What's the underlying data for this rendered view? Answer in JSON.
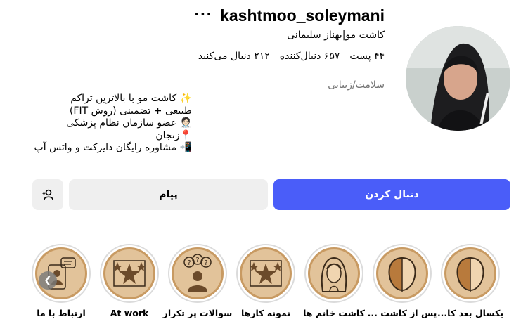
{
  "profile": {
    "username": "kashtmoo_soleymani",
    "more_glyph": "···",
    "full_name": "کاشت مو|بهناز سلیمانی",
    "stats": {
      "posts": "۴۴ پست",
      "followers": "۶۵۷ دنبال‌کننده",
      "following": "۲۱۲ دنبال می‌کنید"
    },
    "category": "سلامت/زیبایی",
    "bio": [
      "✨ کاشت مو با بالاترین تراکم",
      "طبیعی + تضمینی (روش FIT)",
      "🧑🏻‍⚕️ عضو سازمان نظام پزشکی",
      "📍زنجان",
      "📲 مشاوره رایگان دایرکت و واتس آپ"
    ]
  },
  "actions": {
    "follow_label": "دنبال کردن",
    "message_label": "پیام"
  },
  "highlights": [
    {
      "label": "یکسال بعد کا...",
      "icon": "hair-transplant-face-icon"
    },
    {
      "label": "پس از کاشت ...",
      "icon": "hair-transplant-face-icon"
    },
    {
      "label": "کاشت خانم ها",
      "icon": "woman-icon"
    },
    {
      "label": "نمونه کارها",
      "icon": "star-icon"
    },
    {
      "label": "سوالات پر تکرار",
      "icon": "faq-person-icon"
    },
    {
      "label": "At work",
      "icon": "star-icon"
    },
    {
      "label": "ارتباط با ما",
      "icon": "contact-icon"
    }
  ],
  "colors": {
    "accent": "#4a5df9",
    "highlight_fill": "#e2c39a",
    "highlight_border": "#c89a62",
    "muted_text": "#737373"
  }
}
